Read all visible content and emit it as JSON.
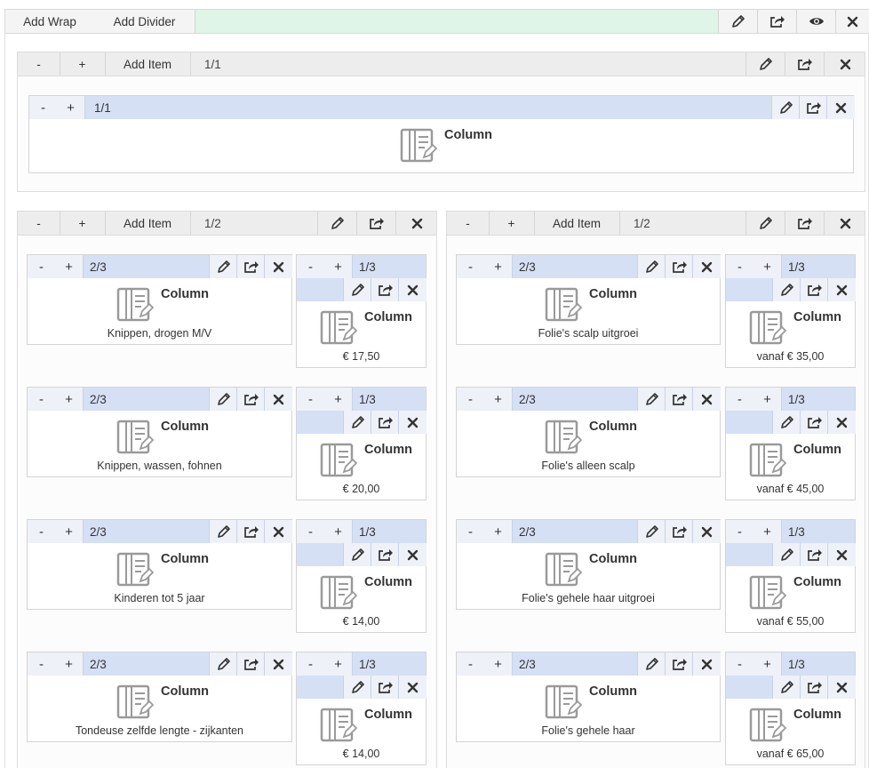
{
  "toolbar": {
    "add_wrap": "Add Wrap",
    "add_divider": "Add Divider",
    "icons": [
      "pencil-icon",
      "share-icon",
      "eye-icon",
      "close-icon"
    ]
  },
  "panel_full": {
    "minus": "-",
    "plus": "+",
    "add_item": "Add Item",
    "ratio": "1/1",
    "column": {
      "minus": "-",
      "plus": "+",
      "ratio": "1/1",
      "title": "Column"
    }
  },
  "panel_left": {
    "minus": "-",
    "plus": "+",
    "add_item": "Add Item",
    "ratio": "1/2"
  },
  "panel_right": {
    "minus": "-",
    "plus": "+",
    "add_item": "Add Item",
    "ratio": "1/2"
  },
  "column_title": "Column",
  "ratio_main": "2/3",
  "ratio_side": "1/3",
  "btn_minus": "-",
  "btn_plus": "+",
  "left_rows": [
    {
      "text": "Knippen, drogen M/V",
      "price": "€ 17,50"
    },
    {
      "text": "Knippen, wassen, fohnen",
      "price": "€ 20,00"
    },
    {
      "text": "Kinderen tot 5 jaar",
      "price": "€ 14,00"
    },
    {
      "text": "Tondeuse zelfde lengte - zijkanten",
      "price": "€ 14,00"
    }
  ],
  "right_rows": [
    {
      "text": "Folie's scalp uitgroei",
      "price": "vanaf € 35,00"
    },
    {
      "text": "Folie's alleen scalp",
      "price": "vanaf € 45,00"
    },
    {
      "text": "Folie's gehele haar uitgroei",
      "price": "vanaf € 55,00"
    },
    {
      "text": "Folie's gehele haar",
      "price": "vanaf € 65,00"
    }
  ]
}
